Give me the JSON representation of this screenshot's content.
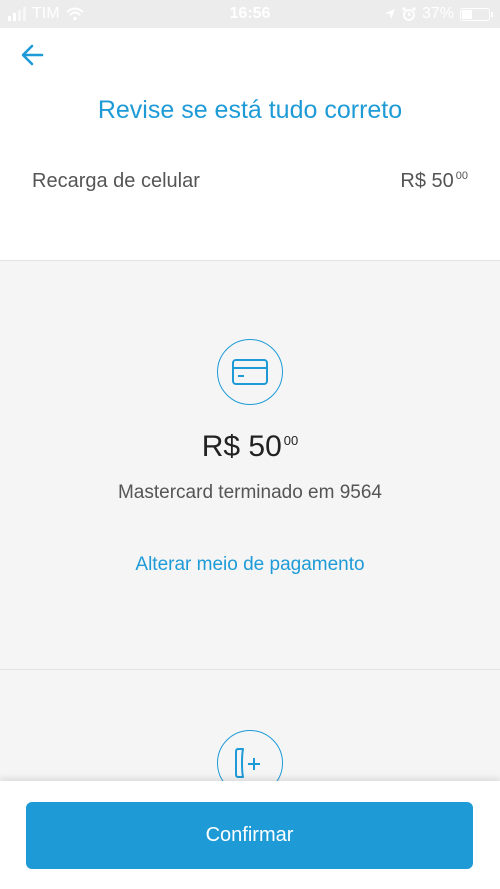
{
  "status_bar": {
    "carrier": "TIM",
    "time": "16:56",
    "battery": "37%",
    "battery_level": 0.37
  },
  "header": {
    "title": "Revise se está tudo correto"
  },
  "summary": {
    "label": "Recarga de celular",
    "amount_main": "R$ 50",
    "amount_cents": "00"
  },
  "payment": {
    "amount_main": "R$ 50",
    "amount_cents": "00",
    "card_description": "Mastercard terminado em 9564",
    "change_link": "Alterar meio de pagamento"
  },
  "footer": {
    "confirm_label": "Confirmar"
  },
  "icons": {
    "back": "arrow-left-icon",
    "card": "credit-card-icon",
    "phone": "phone-plus-icon"
  },
  "colors": {
    "accent": "#1e9bd7",
    "section_bg": "#f5f5f5",
    "status_bar_bg": "#ececec"
  }
}
